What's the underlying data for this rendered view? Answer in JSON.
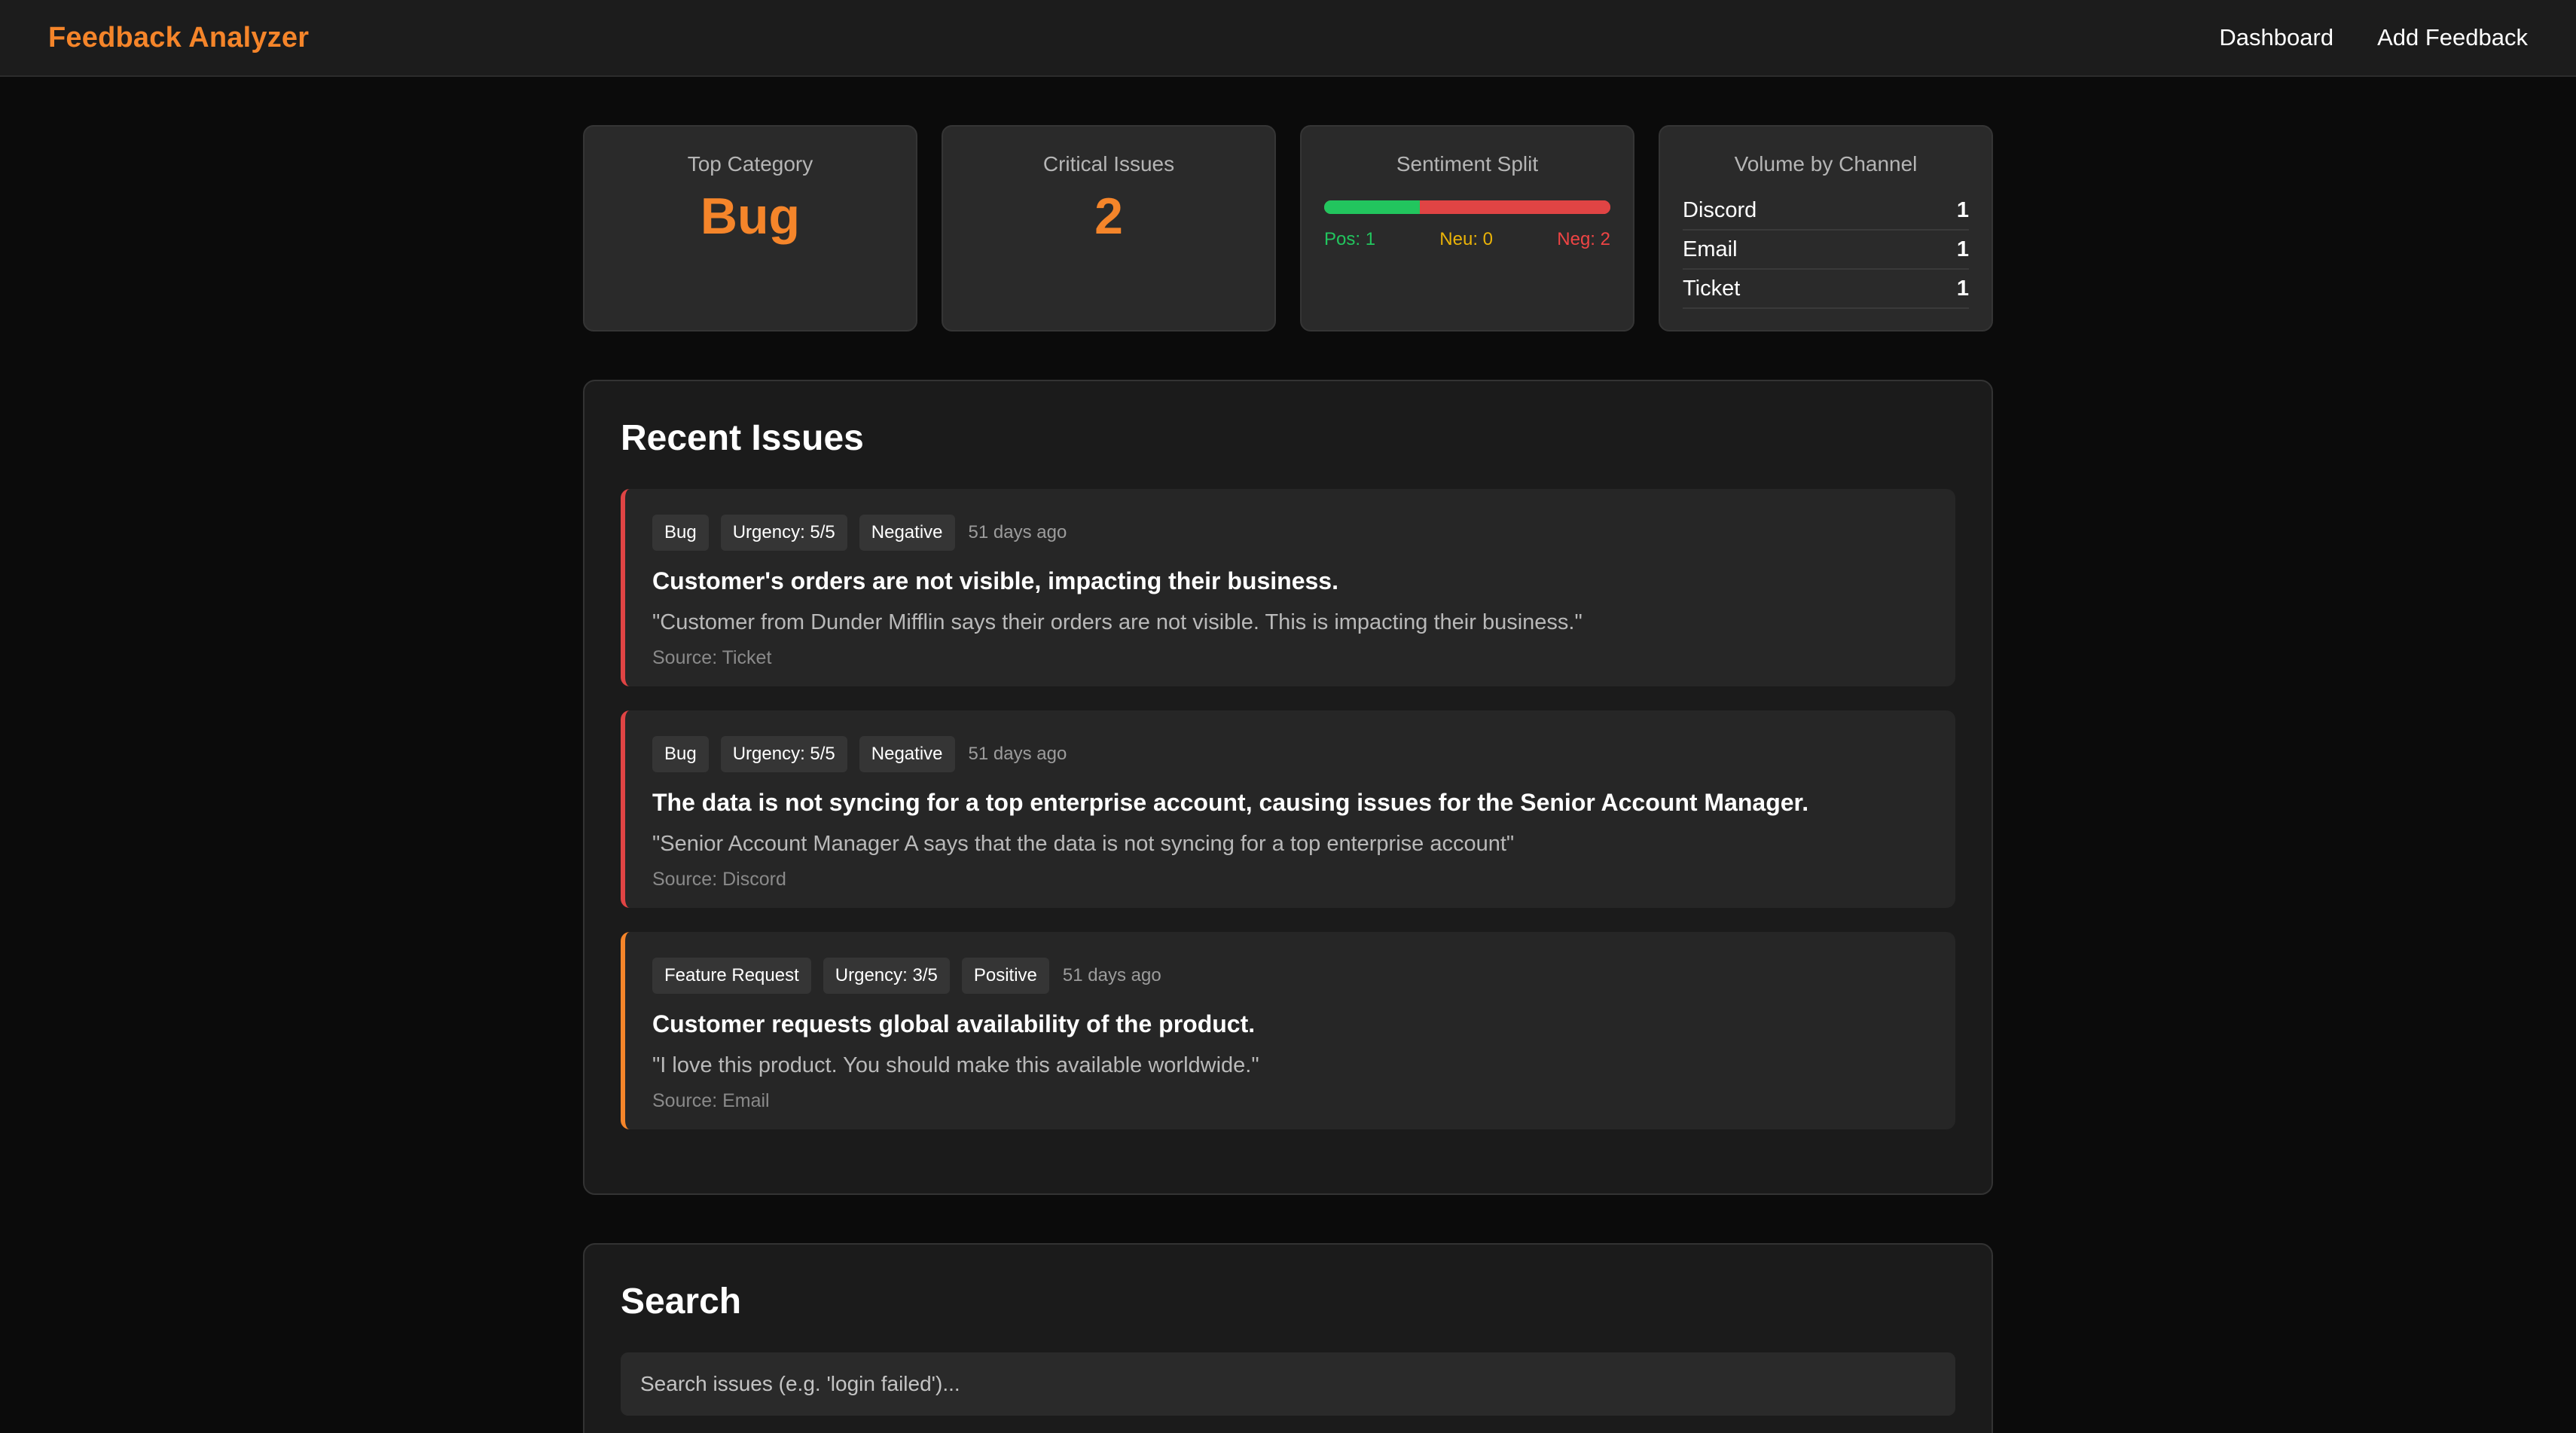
{
  "navbar": {
    "brand": "Feedback Analyzer",
    "links": [
      "Dashboard",
      "Add Feedback"
    ]
  },
  "stats": {
    "top_category": {
      "title": "Top Category",
      "value": "Bug"
    },
    "critical_issues": {
      "title": "Critical Issues",
      "value": "2"
    },
    "sentiment": {
      "title": "Sentiment Split",
      "positive": 1,
      "neutral": 0,
      "negative": 2,
      "pos_label": "Pos: 1",
      "neu_label": "Neu: 0",
      "neg_label": "Neg: 2",
      "colors": {
        "positive": "#22c55e",
        "neutral": "#eab308",
        "negative": "#e04444"
      }
    },
    "channels": {
      "title": "Volume by Channel",
      "rows": [
        {
          "name": "Discord",
          "count": "1"
        },
        {
          "name": "Email",
          "count": "1"
        },
        {
          "name": "Ticket",
          "count": "1"
        }
      ]
    }
  },
  "recent": {
    "title": "Recent Issues",
    "issues": [
      {
        "category": "Bug",
        "urgency": "Urgency: 5/5",
        "sentiment": "Negative",
        "ago": "51 days ago",
        "title": "Customer's orders are not visible, impacting their business.",
        "quote": "\"Customer from Dunder Mifflin says their orders are not visible. This is impacting their business.\"",
        "source": "Source: Ticket"
      },
      {
        "category": "Bug",
        "urgency": "Urgency: 5/5",
        "sentiment": "Negative",
        "ago": "51 days ago",
        "title": "The data is not syncing for a top enterprise account, causing issues for the Senior Account Manager.",
        "quote": "\"Senior Account Manager A says that the data is not syncing for a top enterprise account\"",
        "source": "Source: Discord"
      },
      {
        "category": "Feature Request",
        "urgency": "Urgency: 3/5",
        "sentiment": "Positive",
        "ago": "51 days ago",
        "title": "Customer requests global availability of the product.",
        "quote": "\"I love this product. You should make this available worldwide.\"",
        "source": "Source: Email"
      }
    ]
  },
  "search": {
    "title": "Search",
    "placeholder": "Search issues (e.g. 'login failed')..."
  },
  "colors": {
    "accent": "#f5852a",
    "bug_border": "#e04444",
    "feature_border": "#f5852a"
  }
}
